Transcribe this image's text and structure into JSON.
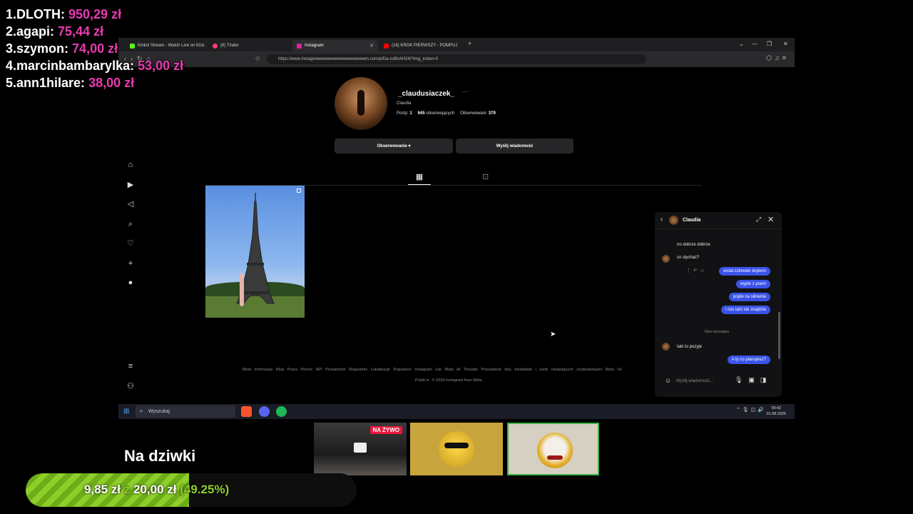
{
  "leaderboard": [
    {
      "name": "1.DLOTH:",
      "amount": "950,29 zł"
    },
    {
      "name": "2.agapi:",
      "amount": "75,44 zł"
    },
    {
      "name": "3.szymon:",
      "amount": "74,00 zł"
    },
    {
      "name": "4.marcinbambarylka:",
      "amount": "53,00 zł"
    },
    {
      "name": "5.ann1hilare:",
      "amount": "38,00 zł"
    }
  ],
  "browser": {
    "tabs": [
      {
        "label": "Kinkoi Stream - Watch Live on Kick"
      },
      {
        "label": "(8) Tinder"
      },
      {
        "label": "Instagram"
      },
      {
        "label": "(16) KROK PIERWSZY - POMPUJ"
      }
    ],
    "new_tab": "+",
    "url": "https://www.instagwwwwwwwwwwwwwwwwwm.com/p/Da-zsBnAH24/?img_index=3"
  },
  "profile": {
    "username": "_claudusiaczek_",
    "more": "···",
    "fullname": "Claudia",
    "posts_label": "Posty:",
    "posts_value": "1",
    "followers_value": "645",
    "followers_label": "obserwujących",
    "following_label": "Obserwowani:",
    "following_value": "379",
    "follow_button": "Obserwowanie ▾",
    "message_button": "Wyślij wiadomość"
  },
  "footer": {
    "links": "Meta Informacje Blog Praca Pomoc API Prywatność Regulamin Lokalizacje Popularne Instagram Lite Meta AI Threads Przesyłanie listy kontaktów i osób niebędących użytkownikami Meta Ve",
    "language": "Polski ▾",
    "copyright": "© 2026 Instagram from Meta"
  },
  "chat": {
    "name": "Claudia",
    "messages": [
      {
        "from": "in",
        "text": "no dobrze dobrze"
      },
      {
        "from": "in",
        "text": "co słychać?"
      },
      {
        "from": "out",
        "text": "wstał człowiek dopiero"
      },
      {
        "from": "out",
        "text": "wyjde z psem"
      },
      {
        "from": "out",
        "text": "pojde na siłownie"
      },
      {
        "from": "out",
        "text": "i cos tam sie znajdzie"
      },
      {
        "from": "in",
        "text": "taki to pozyje"
      },
      {
        "from": "out",
        "text": "A ty co planujesz?"
      }
    ],
    "new_messages_label": "New messages",
    "input_placeholder": "Wyślij wiadomość..."
  },
  "taskbar": {
    "search_placeholder": "Wyszukaj",
    "time": "09:42",
    "date": "01.08.2026"
  },
  "overlay": {
    "live_badge": "NA ŻYWO",
    "goal_title": "Na dziwki",
    "goal_current": "9,85 zł",
    "goal_sep": "z",
    "goal_target": "20,00 zł",
    "goal_percent_label": "(49.25%)",
    "goal_fraction": 0.4925
  },
  "colors": {
    "donation_amount": "#e83ab0",
    "goal_green": "#8fce2a",
    "chat_bubble": "#3b53e8"
  }
}
